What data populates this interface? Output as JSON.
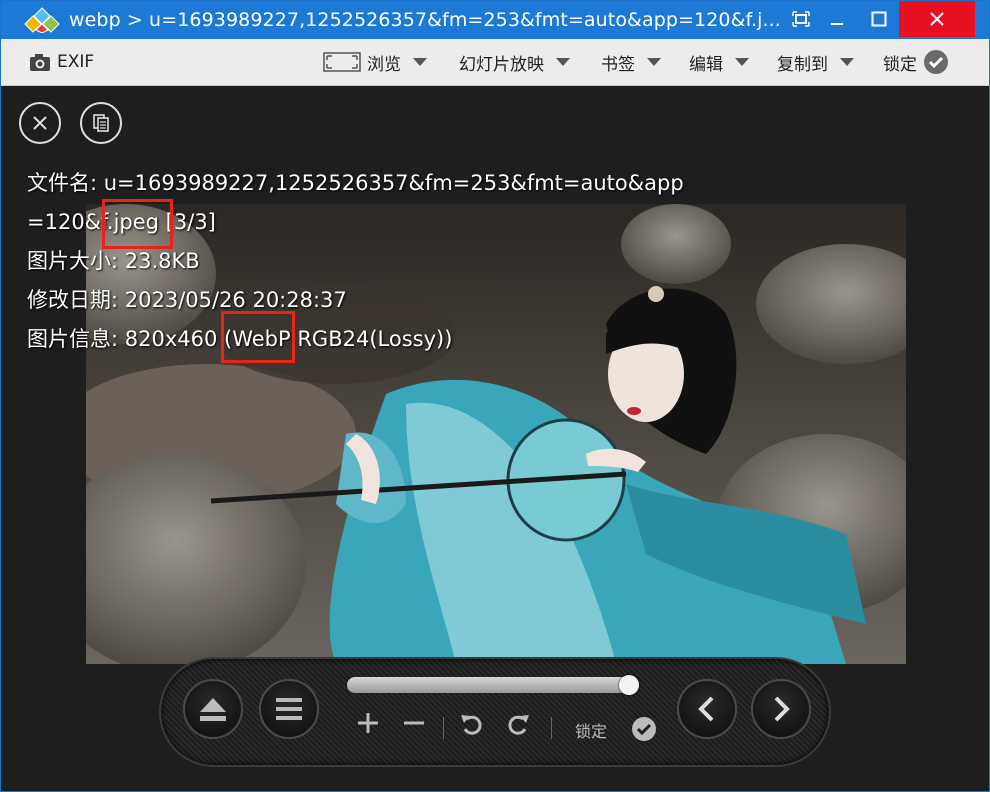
{
  "window": {
    "title": "webp > u=1693989227,1252526357&fm=253&fmt=auto&app=120&f.j...",
    "accent_color": "#1c7ad6",
    "close_color": "#e81123"
  },
  "toolbar": {
    "exif_label": "EXIF",
    "browse_label": "浏览",
    "slideshow_label": "幻灯片放映",
    "bookmark_label": "书签",
    "edit_label": "编辑",
    "copy_to_label": "复制到",
    "lock_label": "锁定"
  },
  "info": {
    "filename_line1": "文件名: u=1693989227,1252526357&fm=253&fmt=auto&app",
    "filename_line2": "=120&f.jpeg [3/3]",
    "size": "图片大小: 23.8KB",
    "modified": "修改日期: 2023/05/26 20:28:37",
    "details": "图片信息: 820x460 (WebP RGB24(Lossy))"
  },
  "controls": {
    "slider_value": 1.0,
    "lock_label": "锁定",
    "icons": [
      "eject-icon",
      "menu-icon",
      "zoom-in-icon",
      "zoom-out-icon",
      "rotate-left-icon",
      "rotate-right-icon",
      "prev-icon",
      "next-icon"
    ]
  },
  "highlight_color": "#e8231b"
}
